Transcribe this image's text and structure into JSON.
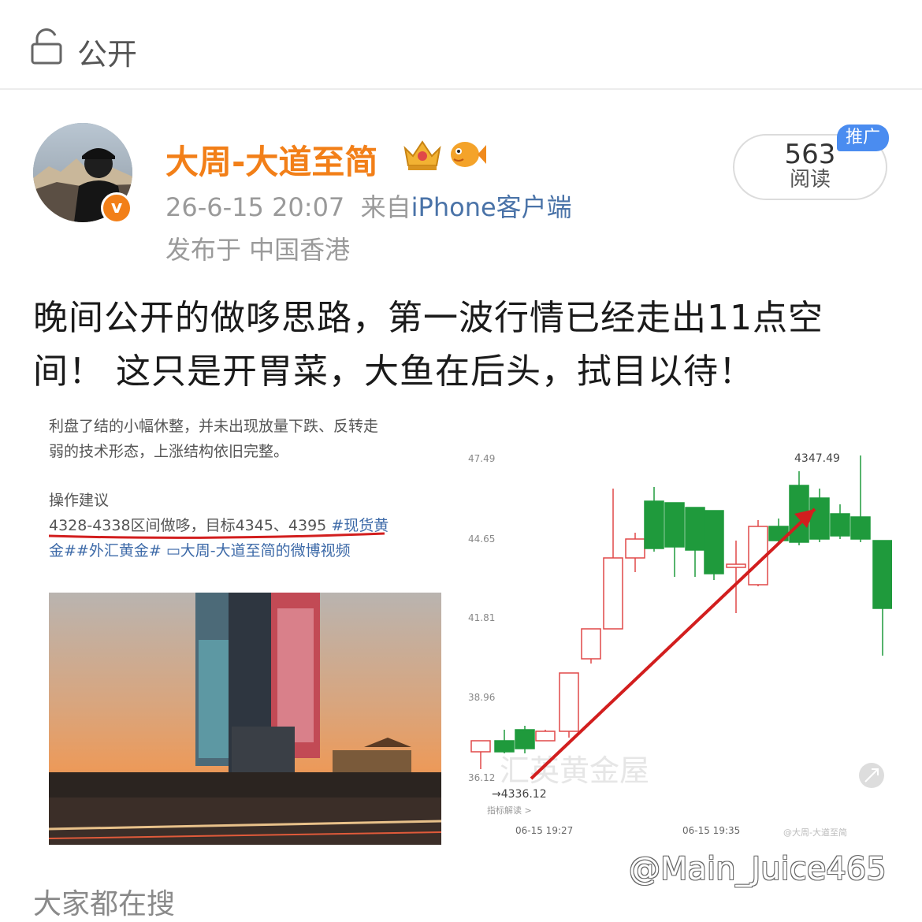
{
  "header": {
    "visibility_label": "公开",
    "lock_icon": "lock-icon"
  },
  "author": {
    "name": "大周-大道至简",
    "badge_icon": "verified-v-icon",
    "badge_char": "v",
    "crown_icon": "crown-icon",
    "fish_icon": "fish-icon",
    "timestamp": "26-6-15 20:07",
    "source_prefix": "来自",
    "source": "iPhone客户端",
    "location": "发布于 中国香港"
  },
  "stats": {
    "reads_count": "563",
    "reads_label": "阅读",
    "promo_badge": "推广"
  },
  "post": {
    "text": "晚间公开的做哆思路，第一波行情已经走出11点空间！ 这只是开胃菜，大鱼在后头，拭目以待！"
  },
  "attachment_left": {
    "line1": "利盘了结的小幅休整，并未出现放量下跌、反转走",
    "line2": "弱的技术形态，上涨结构依旧完整。",
    "heading": "操作建议",
    "advice": "4328-4338区间做哆，目标4345、4395",
    "tag1": "#现货黄",
    "tag2": "金##外汇黄金#",
    "video_link": "大周-大道至简的微博视频"
  },
  "attachment_right": {
    "y_ticks": [
      "47.49",
      "44.65",
      "41.81",
      "38.96",
      "36.12"
    ],
    "high_label": "4347.49",
    "low_label": "4336.12",
    "x_ticks": [
      "06-15 19:27",
      "06-15 19:35"
    ],
    "bg_watermark": "汇英黄金屋",
    "small_caption": "指标解读 >",
    "corner_caption": "@大周-大道至简"
  },
  "footer": {
    "search_label": "大家都在搜",
    "watermark": "@Main_Juice465"
  },
  "colors": {
    "accent": "#f27f18",
    "link": "#4a73a8",
    "up": "#e04848",
    "down": "#1f9a3c",
    "arrow": "#d21e1e"
  }
}
